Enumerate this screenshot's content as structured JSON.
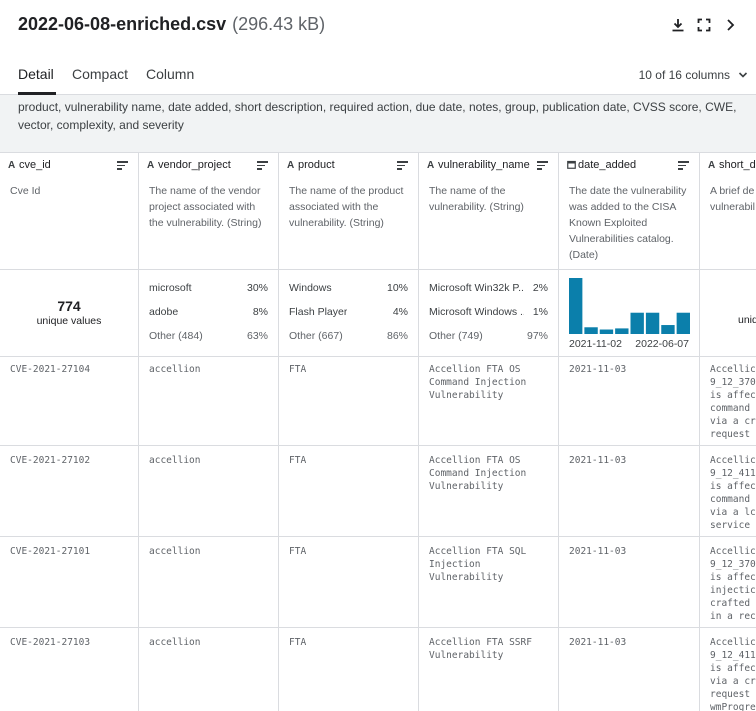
{
  "file": {
    "name": "2022-06-08-enriched.csv",
    "size": "(296.43 kB)"
  },
  "icons": [
    "download-icon",
    "fullscreen-icon",
    "chevron-right-icon"
  ],
  "tabs": [
    {
      "label": "Detail"
    },
    {
      "label": "Compact"
    },
    {
      "label": "Column"
    }
  ],
  "columns_selector": "10 of 16 columns",
  "description": "product, vulnerability name, date added, short description, required action, due date, notes, group, publication date, CVSS score, CWE, vector, complexity, and severity",
  "columns": [
    {
      "type_icon": "A",
      "name": "cve_id",
      "desc": "Cve Id"
    },
    {
      "type_icon": "A",
      "name": "vendor_project",
      "desc": "The name of the vendor project associated with the vulnerability. (String)"
    },
    {
      "type_icon": "A",
      "name": "product",
      "desc": "The name of the product associated with the vulnerability. (String)"
    },
    {
      "type_icon": "A",
      "name": "vulnerability_name",
      "desc": "The name of the vulnerability. (String)"
    },
    {
      "type_icon": "calendar-icon",
      "name": "date_added",
      "desc": "The date the vulnerability was added to the CISA Known Exploited Vulnerabilities catalog. (Date)"
    },
    {
      "type_icon": "A",
      "name": "short_d",
      "desc": "A brief de vulnerabil"
    }
  ],
  "stats": {
    "cve_id": {
      "unique": "774",
      "label": "unique values"
    },
    "vendor_project": [
      {
        "label": "microsoft",
        "pct": "30%"
      },
      {
        "label": "adobe",
        "pct": "8%"
      },
      {
        "label": "Other (484)",
        "pct": "63%"
      }
    ],
    "product": [
      {
        "label": "Windows",
        "pct": "10%"
      },
      {
        "label": "Flash Player",
        "pct": "4%"
      },
      {
        "label": "Other (667)",
        "pct": "86%"
      }
    ],
    "vulnerability_name": [
      {
        "label": "Microsoft Win32k P...",
        "pct": "2%"
      },
      {
        "label": "Microsoft Windows ...",
        "pct": "1%"
      },
      {
        "label": "Other (749)",
        "pct": "97%"
      }
    ],
    "date_added": {
      "start": "2021-11-02",
      "end": "2022-06-07",
      "bars": [
        1.0,
        0.12,
        0.08,
        0.1,
        0.38,
        0.38,
        0.16,
        0.38
      ]
    },
    "short_d": {
      "label": "uniq"
    }
  },
  "rows": [
    {
      "cve_id": "CVE-2021-27104",
      "vendor_project": "accellion",
      "product": "FTA",
      "vulnerability_name": "Accellion FTA OS\nCommand Injection\nVulnerability",
      "date_added": "2021-11-03",
      "short_d": "Accellic\n9_12_370\nis affec\ncommand\nvia a cr\nrequest"
    },
    {
      "cve_id": "CVE-2021-27102",
      "vendor_project": "accellion",
      "product": "FTA",
      "vulnerability_name": "Accellion FTA OS\nCommand Injection\nVulnerability",
      "date_added": "2021-11-03",
      "short_d": "Accellic\n9_12_411\nis affec\ncommand\nvia a lc\nservice"
    },
    {
      "cve_id": "CVE-2021-27101",
      "vendor_project": "accellion",
      "product": "FTA",
      "vulnerability_name": "Accellion FTA SQL\nInjection\nVulnerability",
      "date_added": "2021-11-03",
      "short_d": "Accellic\n9_12_370\nis affec\ninjectic\ncrafted\nin a rec"
    },
    {
      "cve_id": "CVE-2021-27103",
      "vendor_project": "accellion",
      "product": "FTA",
      "vulnerability_name": "Accellion FTA SSRF\nVulnerability",
      "date_added": "2021-11-03",
      "short_d": "Accellic\n9_12_411\nis affec\nvia a cr\nrequest\nwmProgre"
    }
  ]
}
